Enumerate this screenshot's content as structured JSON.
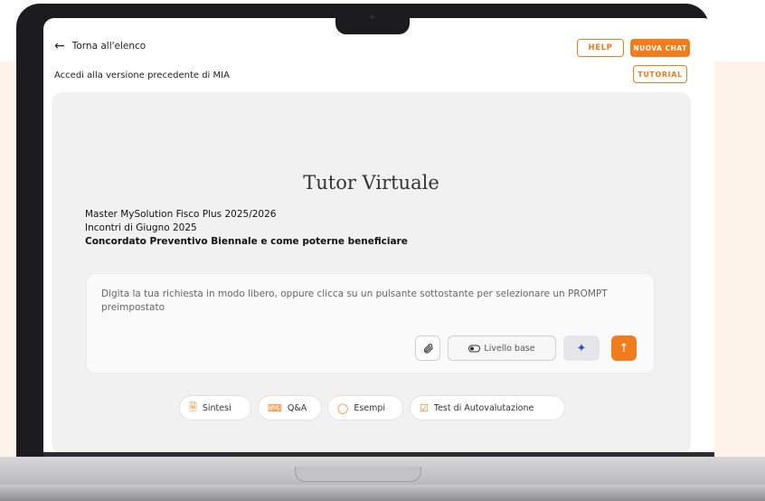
{
  "header": {
    "back_label": "Torna all'elenco",
    "prev_version_label": "Accedi alla versione precedente di MIA",
    "help_label": "HELP",
    "new_chat_label": "NUOVA CHAT",
    "tutorial_label": "TUTORIAL"
  },
  "main": {
    "title": "Tutor Virtuale",
    "course_line1": "Master MySolution Fisco Plus 2025/2026",
    "course_line2": "Incontri di Giugno 2025",
    "course_line3": "Concordato Preventivo Biennale e come poterne beneficiare"
  },
  "input": {
    "placeholder": "Digita la tua richiesta in modo libero, oppure clicca su un pulsante sottostante per selezionare un PROMPT preimpostato",
    "level_label": "Livello base"
  },
  "prompts": [
    {
      "label": "Sintesi",
      "icon": "document-icon"
    },
    {
      "label": "Q&A",
      "icon": "chat-bubbles-icon"
    },
    {
      "label": "Esempi",
      "icon": "lightbulb-icon"
    },
    {
      "label": "Test di Autovalutazione",
      "icon": "checklist-icon"
    }
  ],
  "colors": {
    "accent": "#f07c1b",
    "background_band": "#fdf3ea",
    "panel": "#f1f1f1"
  }
}
